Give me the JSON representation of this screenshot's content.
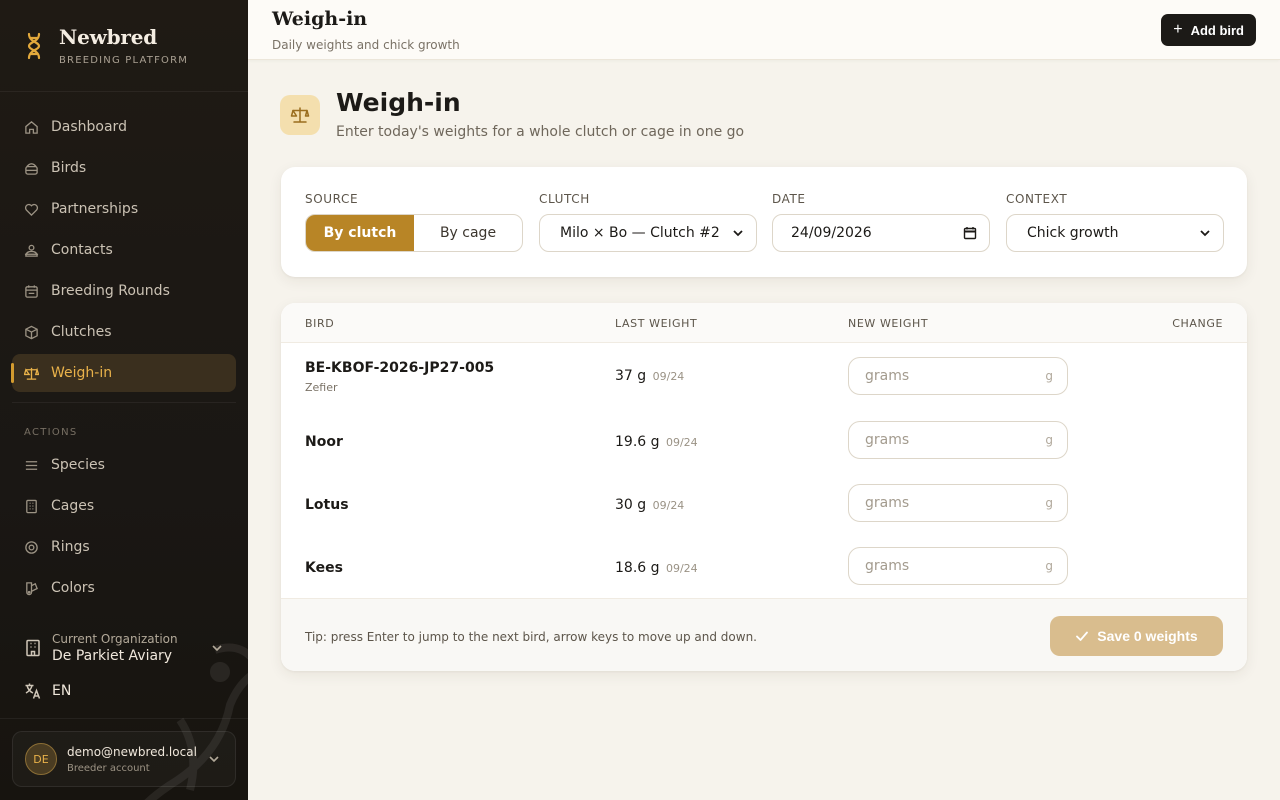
{
  "brand": {
    "name": "Newbred",
    "tagline": "BREEDING PLATFORM"
  },
  "sidebar": {
    "items": [
      {
        "label": "Dashboard",
        "icon": "home-icon"
      },
      {
        "label": "Birds",
        "icon": "nest-icon"
      },
      {
        "label": "Partnerships",
        "icon": "heart-icon"
      },
      {
        "label": "Contacts",
        "icon": "people-icon"
      },
      {
        "label": "Breeding Rounds",
        "icon": "calendar-icon"
      },
      {
        "label": "Clutches",
        "icon": "box-icon"
      },
      {
        "label": "Weigh-in",
        "icon": "scale-icon",
        "active": true
      }
    ],
    "actions_label": "ACTIONS",
    "actions": [
      {
        "label": "Species",
        "icon": "list-icon"
      },
      {
        "label": "Cages",
        "icon": "building-icon"
      },
      {
        "label": "Rings",
        "icon": "ring-icon"
      },
      {
        "label": "Colors",
        "icon": "palette-icon"
      }
    ],
    "org": {
      "label": "Current Organization",
      "name": "De Parkiet Aviary"
    },
    "language": "EN",
    "user": {
      "initials": "DE",
      "email": "demo@newbred.local",
      "role": "Breeder account"
    }
  },
  "topbar": {
    "title": "Weigh-in",
    "subtitle": "Daily weights and chick growth",
    "add_label": "Add bird"
  },
  "page": {
    "title": "Weigh-in",
    "subtitle": "Enter today's weights for a whole clutch or cage in one go"
  },
  "filters": {
    "source_label": "SOURCE",
    "source_options": [
      "By clutch",
      "By cage"
    ],
    "source_selected": "By clutch",
    "clutch_label": "CLUTCH",
    "clutch_value": "Milo × Bo — Clutch #2",
    "date_label": "DATE",
    "date_value": "24/09/2026",
    "context_label": "CONTEXT",
    "context_value": "Chick growth"
  },
  "table": {
    "headers": {
      "bird": "BIRD",
      "last": "LAST WEIGHT",
      "new": "NEW WEIGHT",
      "change": "CHANGE"
    },
    "placeholder": "grams",
    "unit": "g",
    "rows": [
      {
        "id": "BE-KBOF-2026-JP27-005",
        "name": "Zefier",
        "last": "37 g",
        "last_date": "09/24"
      },
      {
        "id": "Noor",
        "name": "",
        "last": "19.6 g",
        "last_date": "09/24"
      },
      {
        "id": "Lotus",
        "name": "",
        "last": "30 g",
        "last_date": "09/24"
      },
      {
        "id": "Kees",
        "name": "",
        "last": "18.6 g",
        "last_date": "09/24"
      }
    ],
    "tip": "Tip: press Enter to jump to the next bird, arrow keys to move up and down.",
    "save_label": "Save 0 weights"
  },
  "colors": {
    "accent": "#b88526",
    "active_nav": "#e9b24a",
    "save_disabled": "#d9bd8e",
    "sidebar_bg": "#1f1a14"
  }
}
